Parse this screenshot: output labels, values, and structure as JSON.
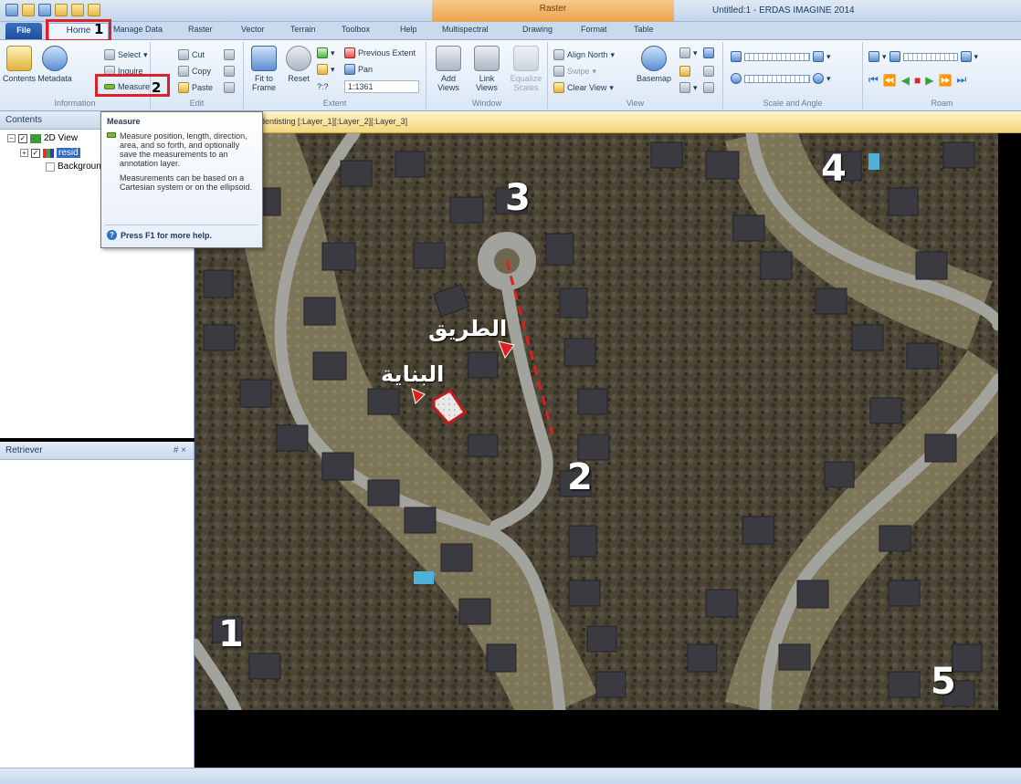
{
  "window": {
    "title": "Untitled:1 - ERDAS IMAGINE 2014",
    "context_tab_group": "Raster"
  },
  "tabs": [
    "File",
    "Home",
    "Manage Data",
    "Raster",
    "Vector",
    "Terrain",
    "Toolbox",
    "Help",
    "Multispectral",
    "Drawing",
    "Format",
    "Table"
  ],
  "annotations": {
    "step1": "1",
    "step2": "2"
  },
  "ribbon": {
    "information": {
      "label": "Information",
      "contents": "Contents",
      "metadata": "Metadata",
      "select": "Select",
      "inquire": "Inquire",
      "measure": "Measure"
    },
    "edit": {
      "label": "Edit",
      "cut": "Cut",
      "copy": "Copy",
      "paste": "Paste"
    },
    "extent": {
      "label": "Extent",
      "fit_to_frame": "Fit to Frame",
      "reset": "Reset",
      "previous_extent": "Previous Extent",
      "pan": "Pan",
      "scale_value": "1:1361",
      "scale_prefix": "?:?"
    },
    "window": {
      "label": "Window",
      "add_views": "Add Views",
      "link_views": "Link Views",
      "equalize_scales": "Equalize Scales"
    },
    "view": {
      "label": "View",
      "align_north": "Align North",
      "swipe": "Swipe",
      "clear_view": "Clear View",
      "basemap": "Basemap"
    },
    "scale_and_angle": {
      "label": "Scale and Angle"
    },
    "roam": {
      "label": "Roam"
    }
  },
  "contents_panel": {
    "title": "Contents",
    "items": [
      {
        "label": "2D View"
      },
      {
        "label": "resid"
      },
      {
        "label": "Background"
      }
    ]
  },
  "retriever_panel": {
    "title": "Retriever",
    "controls": "# ×"
  },
  "viewer": {
    "title": "identisting [:Layer_1][:Layer_2][:Layer_3]"
  },
  "tooltip": {
    "title": "Measure",
    "body1": "Measure position, length, direction, area, and so forth, and optionally save the measurements to an annotation layer.",
    "body2": "Measurements can be based on a Cartesian system or on the ellipsoid.",
    "help": "Press F1 for more help."
  },
  "map": {
    "labels": {
      "road": "الطريق",
      "building": "البناية",
      "n1": "1",
      "n2": "2",
      "n3": "3",
      "n4": "4",
      "n5": "5"
    },
    "colors": {
      "ground": "#4c4a3c",
      "road": "#9a9a96",
      "marker_red": "#e02020"
    }
  }
}
